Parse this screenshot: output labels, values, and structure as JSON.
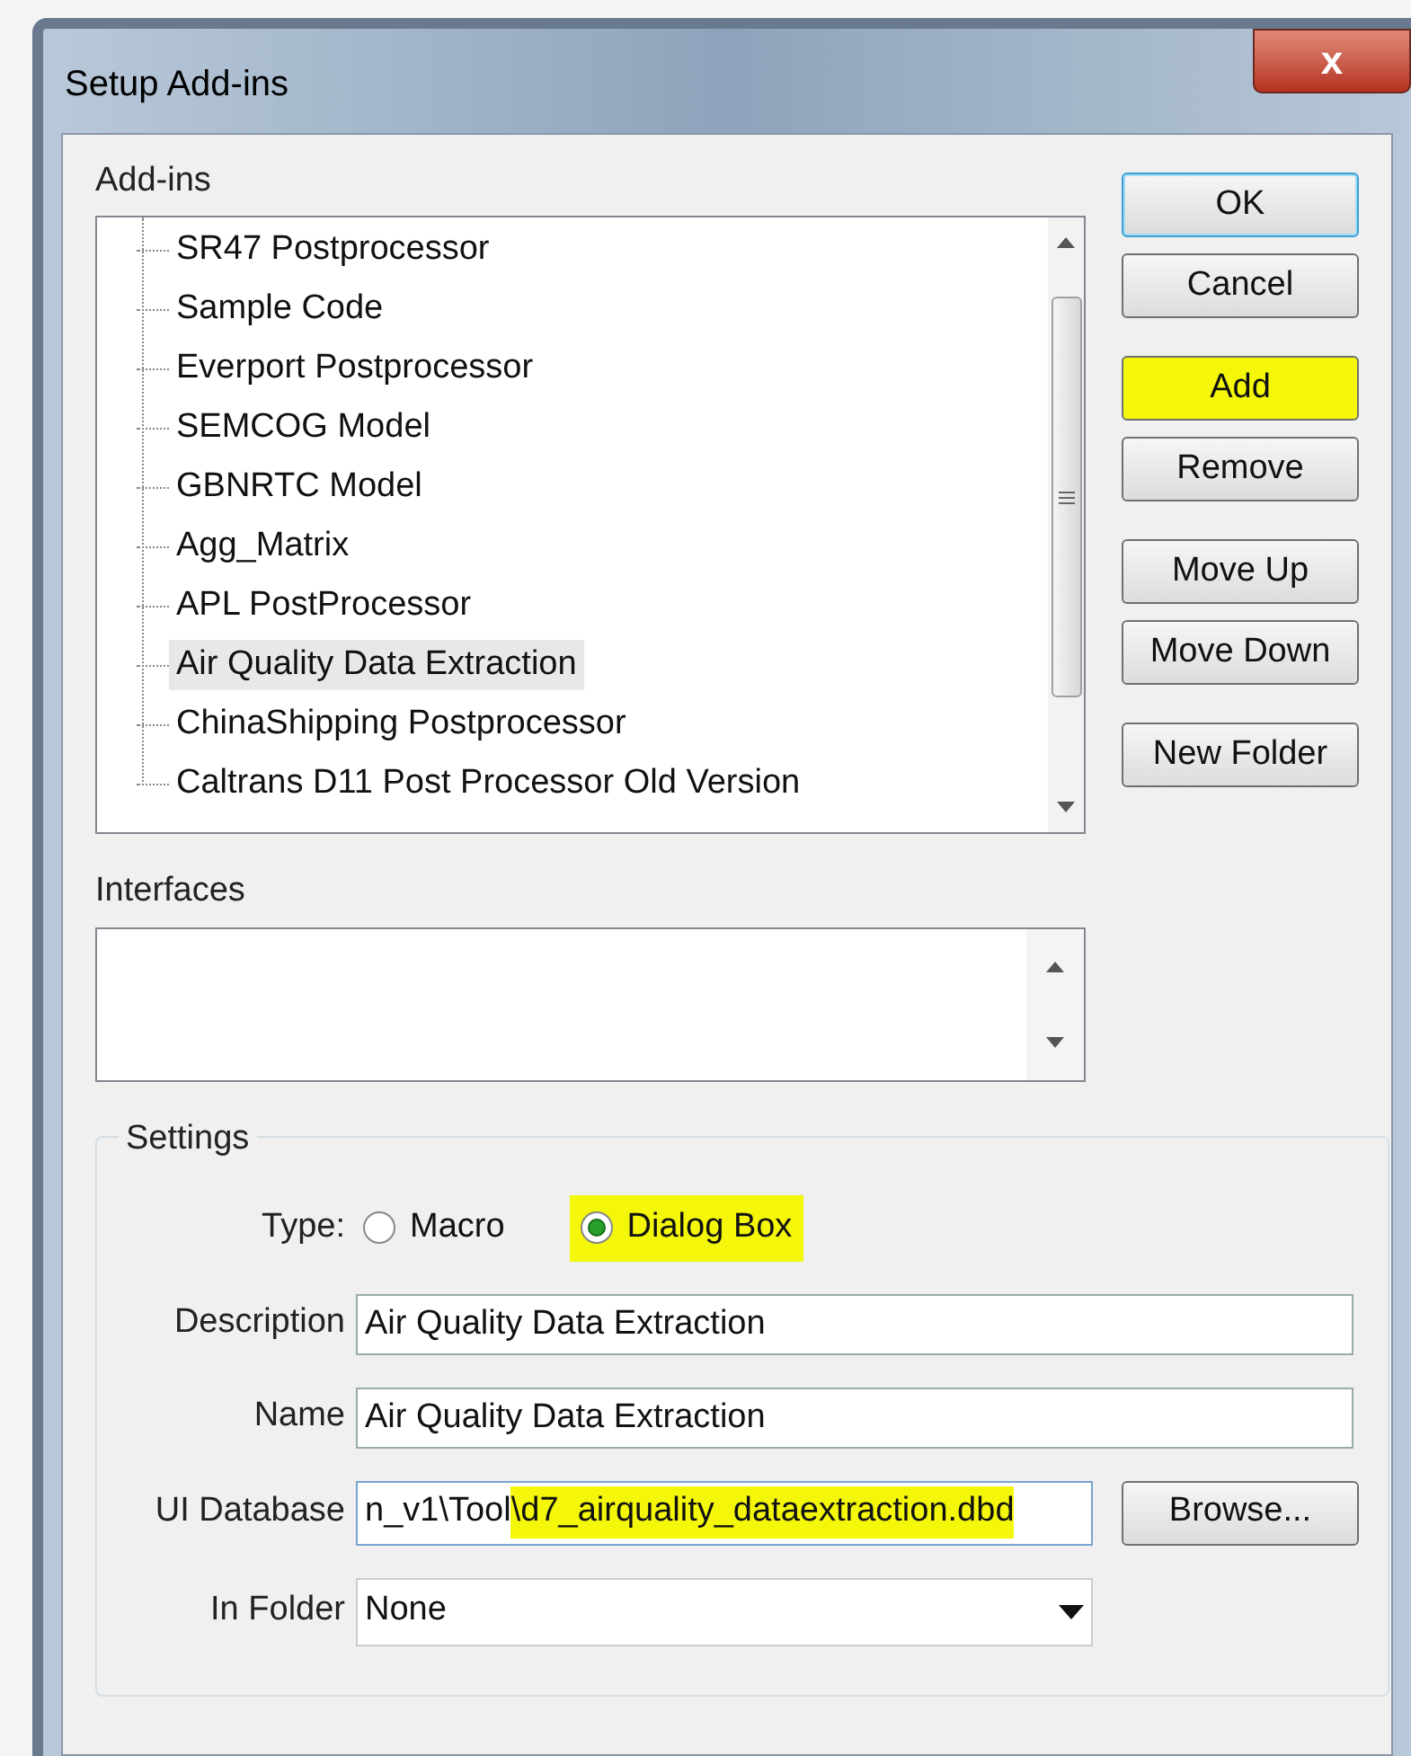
{
  "window": {
    "title": "Setup Add-ins",
    "close": "x"
  },
  "addins": {
    "label": "Add-ins",
    "items": [
      {
        "label": "SR47 Postprocessor",
        "selected": false
      },
      {
        "label": "Sample Code",
        "selected": false
      },
      {
        "label": "Everport Postprocessor",
        "selected": false
      },
      {
        "label": "SEMCOG Model",
        "selected": false
      },
      {
        "label": "GBNRTC Model",
        "selected": false
      },
      {
        "label": "Agg_Matrix",
        "selected": false
      },
      {
        "label": "APL PostProcessor",
        "selected": false
      },
      {
        "label": "Air Quality Data Extraction",
        "selected": true
      },
      {
        "label": "ChinaShipping Postprocessor",
        "selected": false
      },
      {
        "label": "Caltrans D11 Post Processor Old Version",
        "selected": false
      }
    ]
  },
  "buttons": [
    {
      "label": "OK",
      "default": true,
      "highlighted": false
    },
    {
      "label": "Cancel",
      "default": false,
      "highlighted": false
    },
    {
      "label": "Add",
      "default": false,
      "highlighted": true
    },
    {
      "label": "Remove",
      "default": false,
      "highlighted": false
    },
    {
      "label": "Move Up",
      "default": false,
      "highlighted": false
    },
    {
      "label": "Move Down",
      "default": false,
      "highlighted": false
    },
    {
      "label": "New Folder",
      "default": false,
      "highlighted": false
    }
  ],
  "interfaces": {
    "label": "Interfaces"
  },
  "settings": {
    "title": "Settings",
    "type_label": "Type:",
    "types": [
      {
        "label": "Macro",
        "selected": false,
        "highlighted": false
      },
      {
        "label": "Dialog Box",
        "selected": true,
        "highlighted": true
      }
    ],
    "description": {
      "label": "Description",
      "value": "Air Quality Data Extraction"
    },
    "name": {
      "label": "Name",
      "value": "Air Quality Data Extraction"
    },
    "ui_database": {
      "label": "UI Database",
      "value": "n_v1\\Tool",
      "highlighted_value": "\\d7_airquality_dataextraction.dbd",
      "button": "Browse..."
    },
    "in_folder": {
      "label": "In Folder",
      "value": "None"
    }
  }
}
